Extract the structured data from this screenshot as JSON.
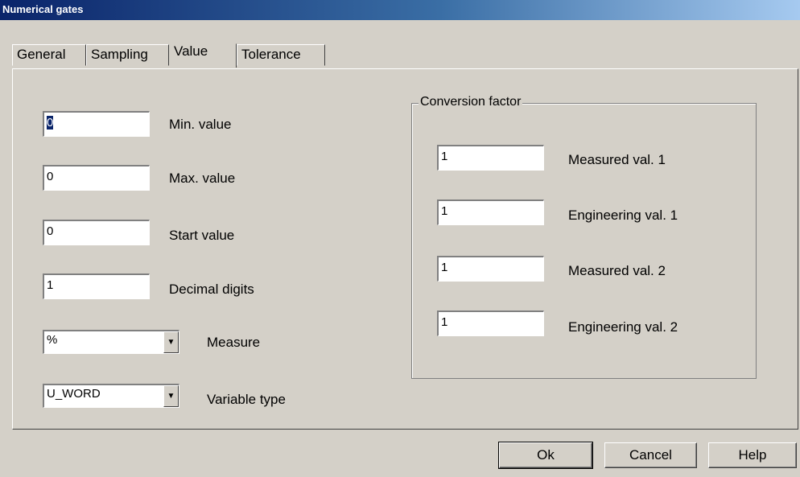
{
  "window": {
    "title": "Numerical gates"
  },
  "tabs": [
    {
      "label": "General"
    },
    {
      "label": "Sampling"
    },
    {
      "label": "Value"
    },
    {
      "label": "Tolerance"
    }
  ],
  "fields": {
    "min_value": {
      "value": "0",
      "label": "Min. value"
    },
    "max_value": {
      "value": "0",
      "label": "Max. value"
    },
    "start_value": {
      "value": "0",
      "label": "Start value"
    },
    "decimal_digits": {
      "value": "1",
      "label": "Decimal digits"
    },
    "measure": {
      "value": "%",
      "label": "Measure"
    },
    "variable_type": {
      "value": "U_WORD",
      "label": "Variable type"
    }
  },
  "conversion": {
    "title": "Conversion factor",
    "measured1": {
      "value": "1",
      "label": "Measured val. 1"
    },
    "engineering1": {
      "value": "1",
      "label": "Engineering val. 1"
    },
    "measured2": {
      "value": "1",
      "label": "Measured val. 2"
    },
    "engineering2": {
      "value": "1",
      "label": "Engineering val. 2"
    }
  },
  "buttons": {
    "ok": "Ok",
    "cancel": "Cancel",
    "help": "Help"
  }
}
